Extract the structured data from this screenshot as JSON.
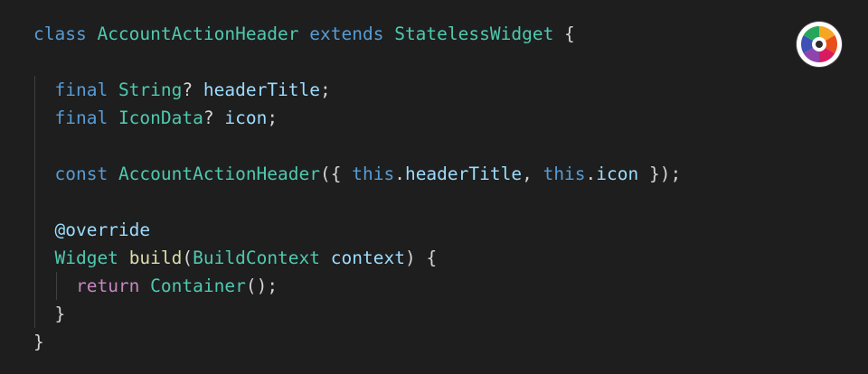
{
  "editor": {
    "background": "#1e1e1e",
    "logo_icon": "color-wheel-icon",
    "lines": [
      [
        {
          "t": "class",
          "c": "kw"
        },
        {
          "t": " ",
          "c": "punct"
        },
        {
          "t": "AccountActionHeader",
          "c": "type"
        },
        {
          "t": " ",
          "c": "punct"
        },
        {
          "t": "extends",
          "c": "kw"
        },
        {
          "t": " ",
          "c": "punct"
        },
        {
          "t": "StatelessWidget",
          "c": "type"
        },
        {
          "t": " {",
          "c": "punct"
        }
      ],
      [],
      [
        {
          "t": "  ",
          "c": "punct"
        },
        {
          "t": "final",
          "c": "kw"
        },
        {
          "t": " ",
          "c": "punct"
        },
        {
          "t": "String",
          "c": "type"
        },
        {
          "t": "? ",
          "c": "punct"
        },
        {
          "t": "headerTitle",
          "c": "var"
        },
        {
          "t": ";",
          "c": "punct"
        }
      ],
      [
        {
          "t": "  ",
          "c": "punct"
        },
        {
          "t": "final",
          "c": "kw"
        },
        {
          "t": " ",
          "c": "punct"
        },
        {
          "t": "IconData",
          "c": "type"
        },
        {
          "t": "? ",
          "c": "punct"
        },
        {
          "t": "icon",
          "c": "var"
        },
        {
          "t": ";",
          "c": "punct"
        }
      ],
      [],
      [
        {
          "t": "  ",
          "c": "punct"
        },
        {
          "t": "const",
          "c": "kw"
        },
        {
          "t": " ",
          "c": "punct"
        },
        {
          "t": "AccountActionHeader",
          "c": "type"
        },
        {
          "t": "({ ",
          "c": "punct"
        },
        {
          "t": "this",
          "c": "kw"
        },
        {
          "t": ".",
          "c": "punct"
        },
        {
          "t": "headerTitle",
          "c": "var"
        },
        {
          "t": ", ",
          "c": "punct"
        },
        {
          "t": "this",
          "c": "kw"
        },
        {
          "t": ".",
          "c": "punct"
        },
        {
          "t": "icon",
          "c": "var"
        },
        {
          "t": " });",
          "c": "punct"
        }
      ],
      [],
      [
        {
          "t": "  ",
          "c": "punct"
        },
        {
          "t": "@override",
          "c": "var"
        }
      ],
      [
        {
          "t": "  ",
          "c": "punct"
        },
        {
          "t": "Widget",
          "c": "type"
        },
        {
          "t": " ",
          "c": "punct"
        },
        {
          "t": "build",
          "c": "fn"
        },
        {
          "t": "(",
          "c": "punct"
        },
        {
          "t": "BuildContext",
          "c": "type"
        },
        {
          "t": " ",
          "c": "punct"
        },
        {
          "t": "context",
          "c": "var"
        },
        {
          "t": ") {",
          "c": "punct"
        }
      ],
      [
        {
          "t": "    ",
          "c": "punct"
        },
        {
          "t": "return",
          "c": "ctrl"
        },
        {
          "t": " ",
          "c": "punct"
        },
        {
          "t": "Container",
          "c": "type"
        },
        {
          "t": "();",
          "c": "punct"
        }
      ],
      [
        {
          "t": "  ",
          "c": "punct"
        },
        {
          "t": "}",
          "c": "punct"
        }
      ],
      [
        {
          "t": "}",
          "c": "punct"
        }
      ]
    ],
    "guides": [
      [],
      [],
      [
        1
      ],
      [
        1
      ],
      [
        1
      ],
      [
        1
      ],
      [
        1
      ],
      [
        1
      ],
      [
        1
      ],
      [
        1,
        2
      ],
      [
        1
      ],
      []
    ]
  }
}
